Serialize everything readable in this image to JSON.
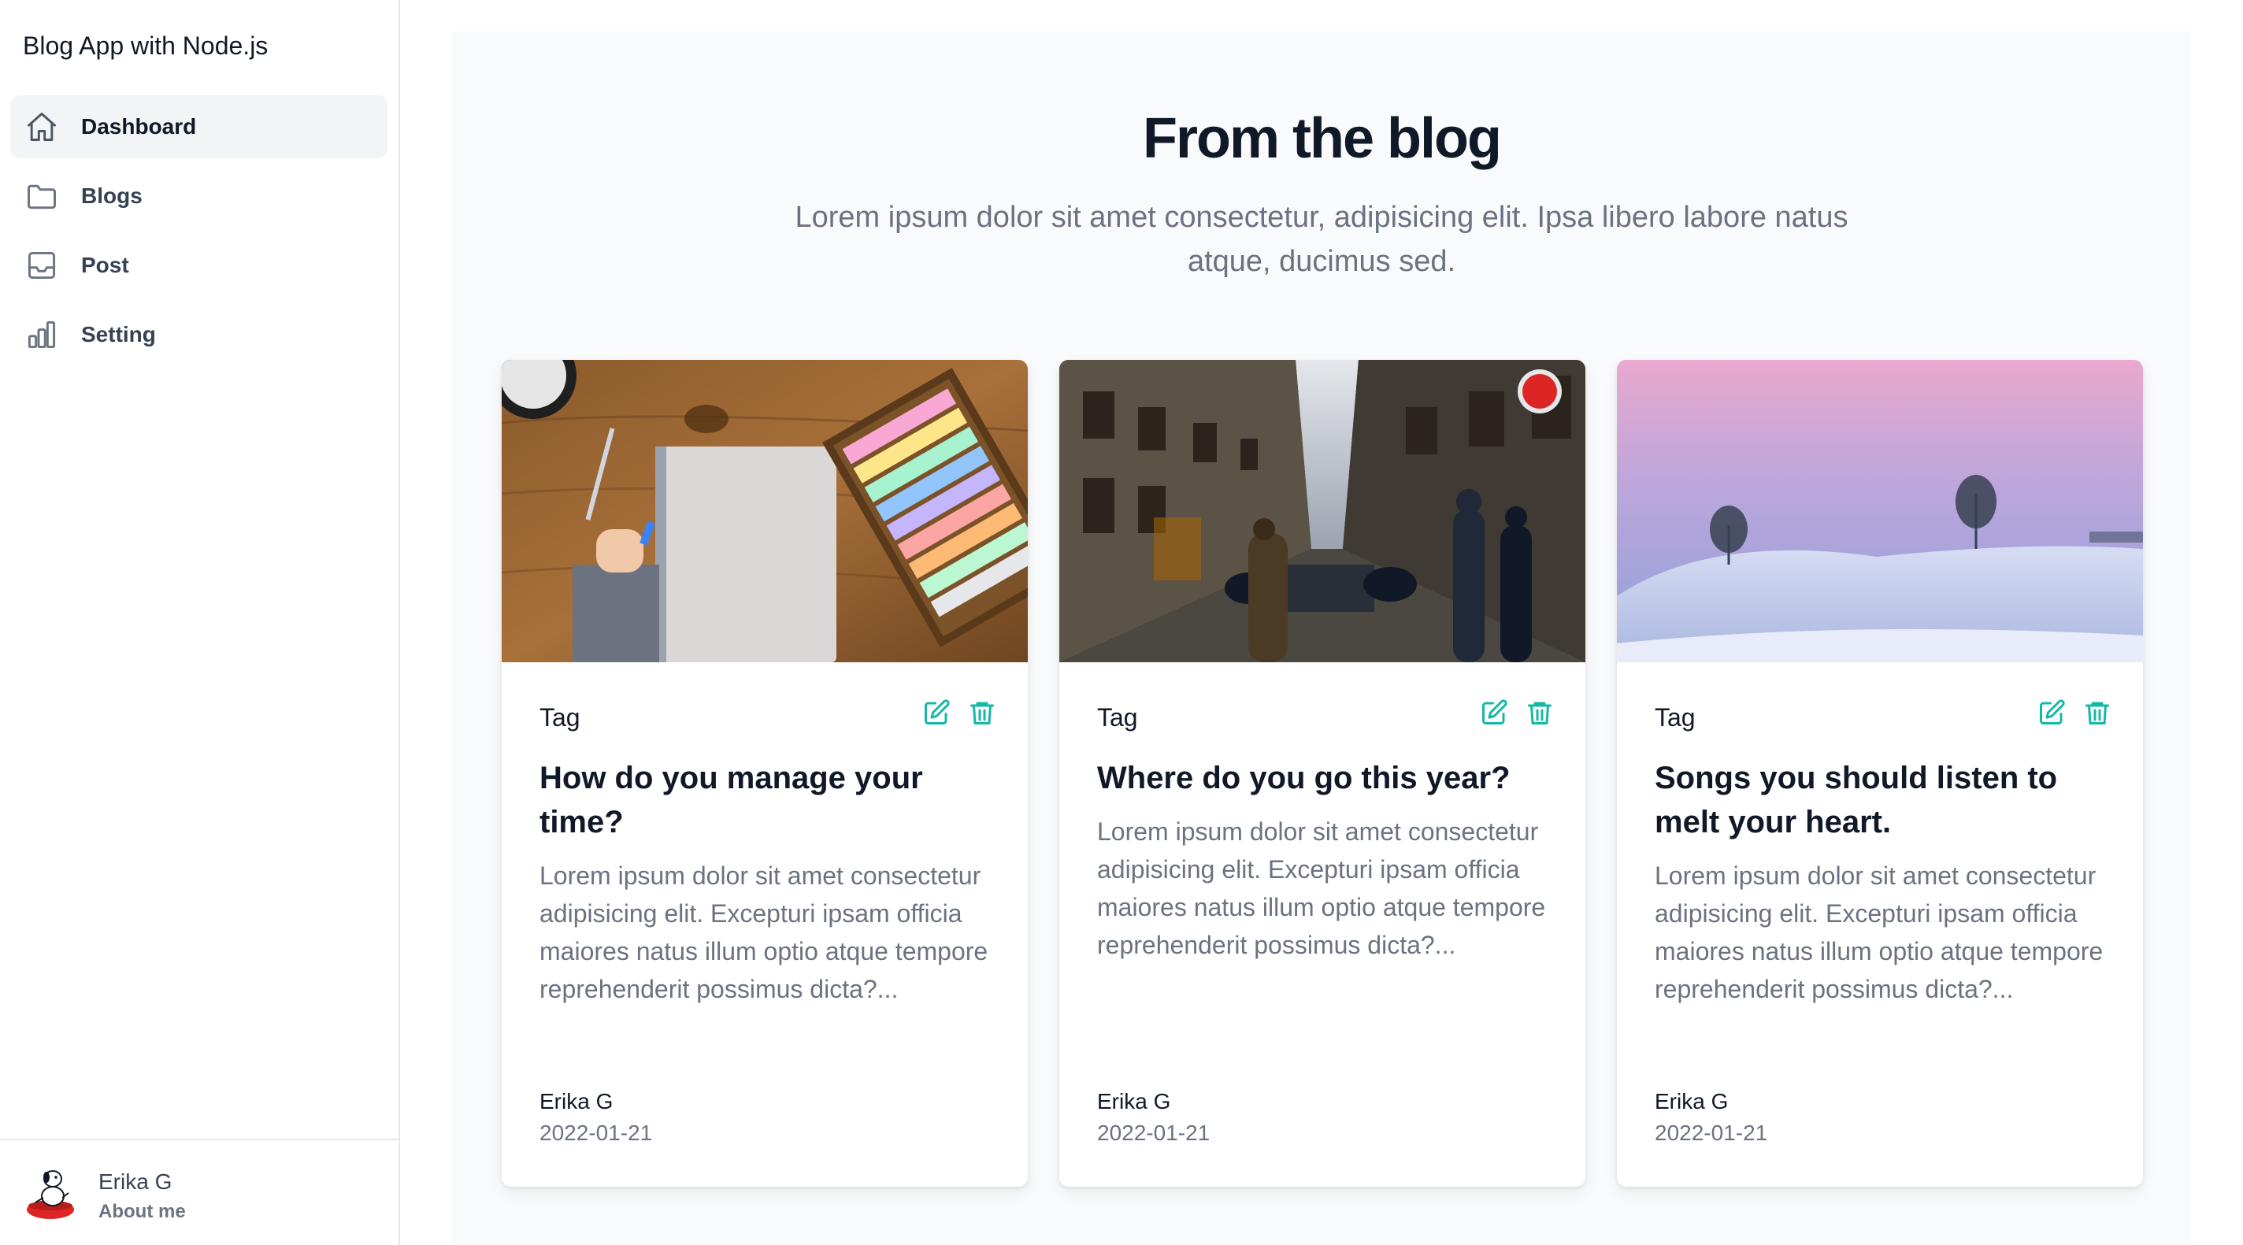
{
  "app": {
    "title": "Blog App with Node.js"
  },
  "sidebar": {
    "items": [
      {
        "label": "Dashboard",
        "icon": "home-icon",
        "active": true
      },
      {
        "label": "Blogs",
        "icon": "folder-icon",
        "active": false
      },
      {
        "label": "Post",
        "icon": "inbox-icon",
        "active": false
      },
      {
        "label": "Setting",
        "icon": "chart-bar-icon",
        "active": false
      }
    ],
    "profile": {
      "name": "Erika G",
      "subtitle": "About me"
    }
  },
  "hero": {
    "title": "From the blog",
    "subtitle": "Lorem ipsum dolor sit amet consectetur, adipisicing elit. Ipsa libero labore natus atque, ducimus sed."
  },
  "posts": [
    {
      "tag": "Tag",
      "title": "How do you manage your time?",
      "excerpt": "Lorem ipsum dolor sit amet consectetur adipisicing elit. Excepturi ipsam officia maiores natus illum optio atque tempore reprehenderit possimus dicta?...",
      "author": "Erika G",
      "date": "2022-01-21",
      "image": "desk-notebook-pastels"
    },
    {
      "tag": "Tag",
      "title": "Where do you go this year?",
      "excerpt": "Lorem ipsum dolor sit amet consectetur adipisicing elit. Excepturi ipsam officia maiores natus illum optio atque tempore reprehenderit possimus dicta?...",
      "author": "Erika G",
      "date": "2022-01-21",
      "image": "city-street"
    },
    {
      "tag": "Tag",
      "title": "Songs you should listen to melt your heart.",
      "excerpt": "Lorem ipsum dolor sit amet consectetur adipisicing elit. Excepturi ipsam officia maiores natus illum optio atque tempore reprehenderit possimus dicta?...",
      "author": "Erika G",
      "date": "2022-01-21",
      "image": "snowy-hill-trees"
    }
  ],
  "colors": {
    "accent": "#14b8a6",
    "page_bg": "#f9fafb",
    "sidebar_active_bg": "#f3f4f6"
  }
}
